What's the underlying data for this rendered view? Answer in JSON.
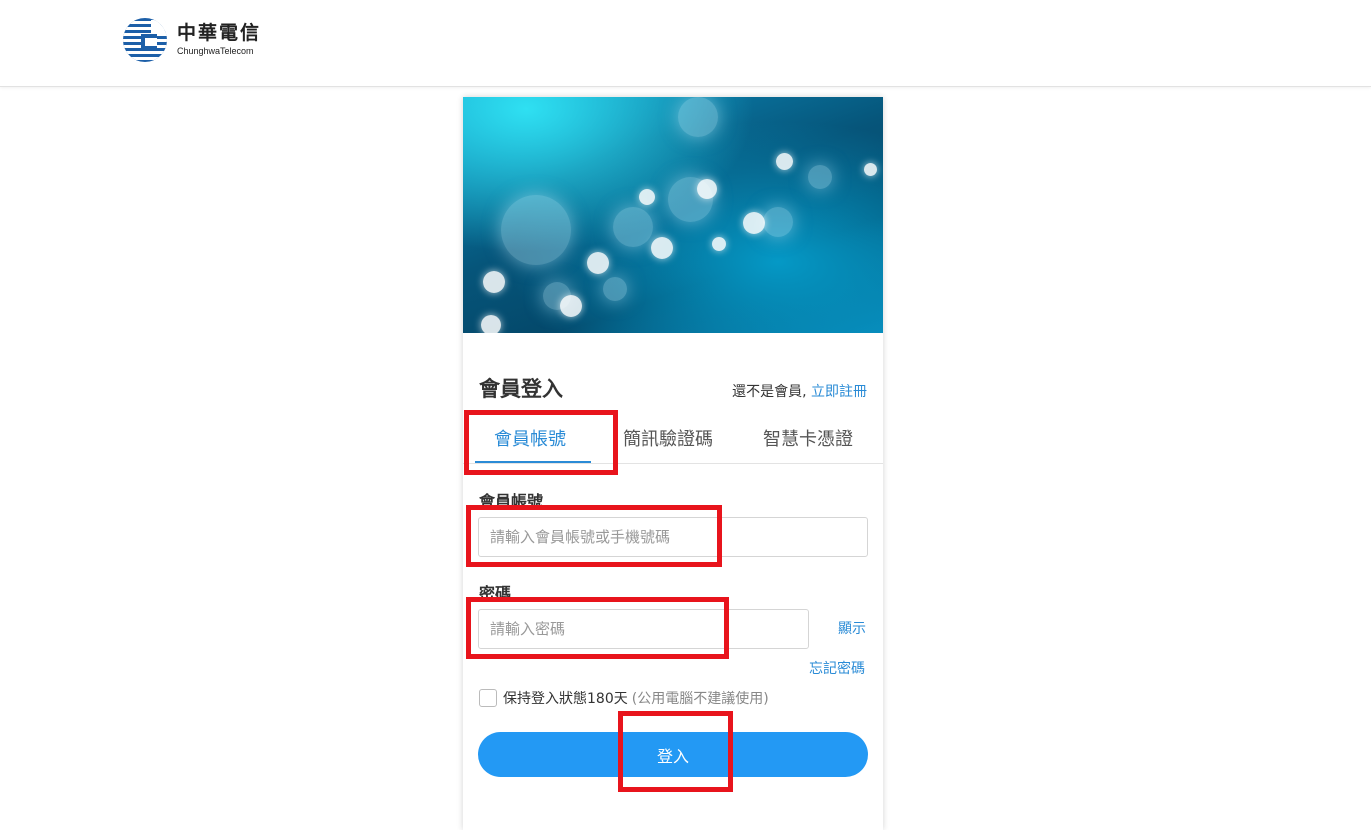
{
  "header": {
    "logo_zh": "中華電信",
    "logo_en": "ChunghwaTelecom",
    "brand_color": "#1c5fa8"
  },
  "login": {
    "title": "會員登入",
    "register_prompt": "還不是會員,",
    "register_link": "立即註冊",
    "tabs": [
      {
        "label": "會員帳號",
        "active": true
      },
      {
        "label": "簡訊驗證碼",
        "active": false
      },
      {
        "label": "智慧卡憑證",
        "active": false
      }
    ],
    "account_label": "會員帳號",
    "account_placeholder": "請輸入會員帳號或手機號碼",
    "password_label": "密碼",
    "password_placeholder": "請輸入密碼",
    "show_password": "顯示",
    "forgot_password": "忘記密碼",
    "remember_label": "保持登入狀態180天",
    "remember_note": "(公用電腦不建議使用)",
    "remember_checked": false,
    "submit_label": "登入",
    "accent_color": "#2399f4",
    "highlight_color": "#e8141c"
  }
}
